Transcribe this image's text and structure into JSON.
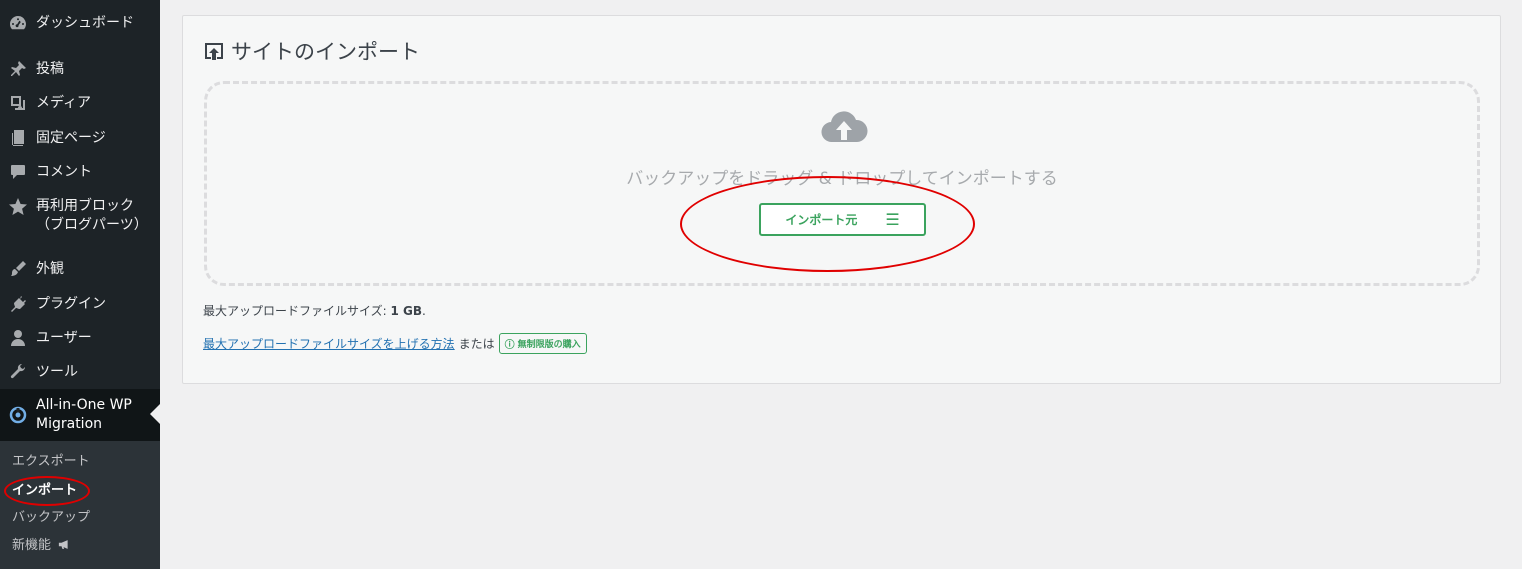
{
  "sidebar": {
    "items": [
      {
        "label": "ダッシュボード",
        "icon": "dashboard-icon"
      },
      {
        "label": "投稿",
        "icon": "pin-icon"
      },
      {
        "label": "メディア",
        "icon": "media-icon"
      },
      {
        "label": "固定ページ",
        "icon": "page-icon"
      },
      {
        "label": "コメント",
        "icon": "comment-icon"
      },
      {
        "label": "再利用ブロック\n（ブログパーツ）",
        "icon": "star-icon"
      },
      {
        "label": "外観",
        "icon": "brush-icon"
      },
      {
        "label": "プラグイン",
        "icon": "plugin-icon"
      },
      {
        "label": "ユーザー",
        "icon": "user-icon"
      },
      {
        "label": "ツール",
        "icon": "wrench-icon"
      }
    ],
    "active": {
      "label": "All-in-One WP\nMigration",
      "icon": "ai1wm-icon"
    },
    "submenu": [
      "エクスポート",
      "インポート",
      "バックアップ",
      "新機能"
    ],
    "submenu_current": "インポート"
  },
  "main": {
    "title": "サイトのインポート",
    "drop_text": "バックアップをドラッグ & ドロップしてインポートする",
    "import_button": "インポート元",
    "max_size_label": "最大アップロードファイルサイズ:",
    "max_size_value": "1 GB",
    "max_size_end": ".",
    "help_link": "最大アップロードファイルサイズを上げる方法",
    "or_text": "または",
    "unlimited_badge": "無制限版の購入"
  },
  "colors": {
    "sidebar_bg": "#1d2327",
    "active_bg": "#101517",
    "accent_green": "#3ba35e",
    "annotation_red": "#e00000",
    "link_blue": "#2271b1"
  }
}
